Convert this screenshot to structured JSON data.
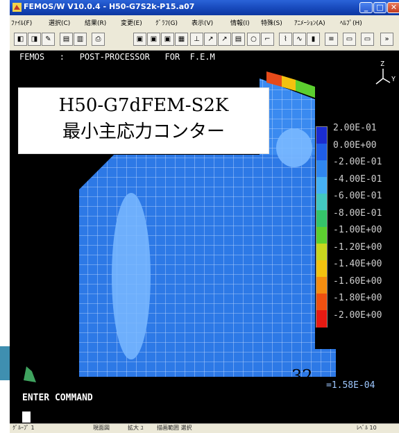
{
  "window": {
    "title": "FEMOS/W V10.0.4 - H50-G7S2k-P15.a07",
    "minimize_glyph": "_",
    "maximize_glyph": "□",
    "close_glyph": "✕",
    "title_color": "#1546b8"
  },
  "menubar": {
    "items": [
      {
        "label": "ﾌｧｲﾙ(F)"
      },
      {
        "label": "選択(C)"
      },
      {
        "label": "結果(R)"
      },
      {
        "label": "変更(E)"
      },
      {
        "label": "ｸﾞﾗﾌ(G)"
      },
      {
        "label": "表示(V)"
      },
      {
        "label": "情報(I)"
      },
      {
        "label": "特殊(S)"
      },
      {
        "label": "ｱﾆﾒｰｼｮﾝ(A)"
      },
      {
        "label": "ﾍﾙﾌﾟ(H)"
      }
    ]
  },
  "toolbar": {
    "icons": [
      "open-icon",
      "print-icon",
      "edit-icon",
      "list-icon",
      "table-icon",
      "printer-icon",
      "view-front-icon",
      "view-side-icon",
      "view-top-icon",
      "view-3d-icon",
      "axis-icon",
      "arrow-icon",
      "arrow-alt-icon",
      "chart-icon",
      "circle-icon",
      "node-icon",
      "graph-icon",
      "graph-line-icon",
      "graph-bar-icon",
      "stress-icon",
      "window-icon",
      "window-alt-icon"
    ],
    "overflow_glyph": "»"
  },
  "viewport": {
    "header": "FEMOS   :   POST-PROCESSOR   FOR  F.E.M",
    "axis_z": "Z",
    "axis_y": "Y",
    "overlay_title_line1": "H50-G7dFEM-S2K",
    "overlay_title_line2": "最小主応力コンター",
    "page_number": "32",
    "result_text": "=1.58E-04"
  },
  "legend": {
    "labels": [
      "2.00E-01",
      "0.00E+00",
      "-2.00E-01",
      "-4.00E-01",
      "-6.00E-01",
      "-8.00E-01",
      "-1.00E+00",
      "-1.20E+00",
      "-1.40E+00",
      "-1.60E+00",
      "-1.80E+00",
      "-2.00E+00"
    ],
    "colors": [
      "#1a2cd0",
      "#1f5ee8",
      "#2f86f0",
      "#46b0f4",
      "#43c7c0",
      "#35c46a",
      "#5ccf2f",
      "#c8d61e",
      "#f3c20f",
      "#f48d10",
      "#ee5010",
      "#e61a12"
    ]
  },
  "command": {
    "label": "ENTER COMMAND"
  },
  "statusbar": {
    "items": [
      "ｸﾞﾙｰﾌﾟ 1",
      "現面図",
      "拡大 ﾕ",
      "描画範囲 選択",
      "ﾚﾍﾞﾙ 10"
    ]
  }
}
